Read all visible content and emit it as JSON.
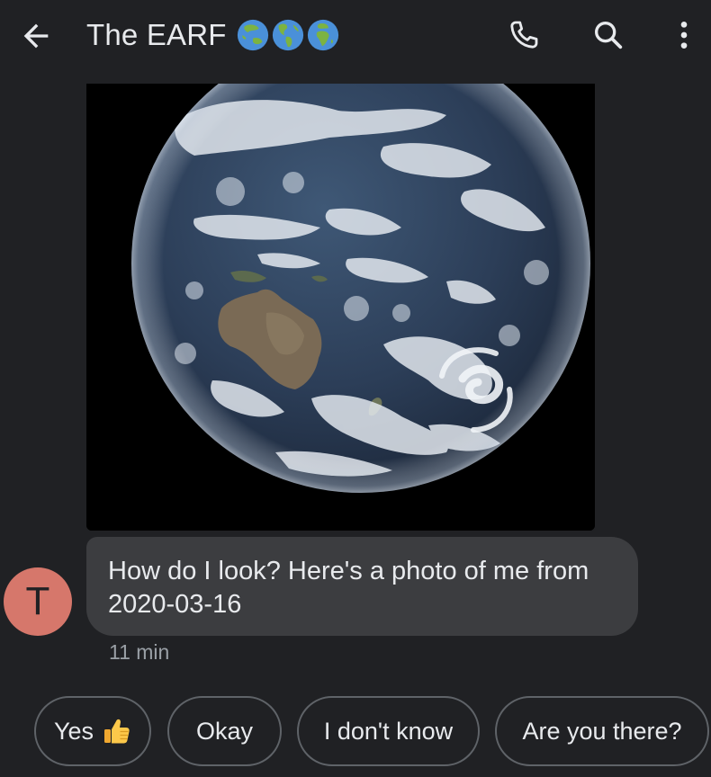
{
  "header": {
    "title": "The EARF",
    "emoji": [
      "globe-asia-australia-icon",
      "globe-americas-icon",
      "globe-europe-africa-icon"
    ],
    "actions": [
      "back-arrow-icon",
      "phone-icon",
      "search-icon",
      "more-vert-icon"
    ]
  },
  "conversation": {
    "image_message": {
      "icon": "earth-photo"
    },
    "sender_avatar_letter": "T",
    "text_message": "How do I look? Here's a photo of me from 2020-03-16",
    "timestamp": "11 min"
  },
  "smart_replies": [
    {
      "label": "Yes",
      "icon": "thumbs-up-icon"
    },
    {
      "label": "Okay"
    },
    {
      "label": "I don't know"
    },
    {
      "label": "Are you there?"
    }
  ],
  "colors": {
    "background": "#202124",
    "bubble": "#3c3d40",
    "avatar": "#d6776b",
    "chip_border": "#5f6368",
    "text": "#e8eaed",
    "secondary_text": "#9aa0a6"
  }
}
